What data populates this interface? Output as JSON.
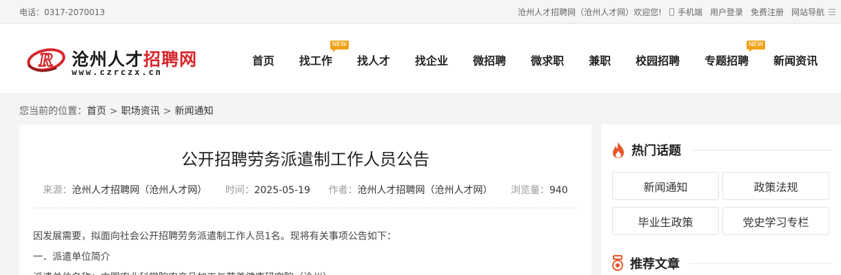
{
  "topbar": {
    "phone": "电话：0317-2070013",
    "welcome": "沧州人才招聘网（沧州人才网）欢迎您!",
    "mobile": "手机端",
    "login": "用户登录",
    "register": "免费注册",
    "sitenav": "网站导航"
  },
  "logo": {
    "title_part1": "沧州人才",
    "title_part2": "招聘网",
    "url": "www.czrczx.cn",
    "brand_color": "#d6262c"
  },
  "nav": {
    "items": [
      {
        "label": "首页"
      },
      {
        "label": "找工作",
        "badge": "NEW"
      },
      {
        "label": "找人才"
      },
      {
        "label": "找企业"
      },
      {
        "label": "微招聘"
      },
      {
        "label": "微求职"
      },
      {
        "label": "兼职"
      },
      {
        "label": "校园招聘"
      },
      {
        "label": "专题招聘",
        "badge": "NEW"
      },
      {
        "label": "新闻资讯"
      }
    ]
  },
  "breadcrumb": {
    "prefix": "您当前的位置：",
    "items": [
      "首页",
      "职场资讯",
      "新闻通知"
    ],
    "separator": ">"
  },
  "article": {
    "title": "公开招聘劳务派遣制工作人员公告",
    "source_label": "来源：",
    "source": "沧州人才招聘网（沧州人才网）",
    "time_label": "时间：",
    "time": "2025-05-19",
    "author_label": "作者：",
    "author": "沧州人才招聘网（沧州人才网）",
    "views_label": "浏览量：",
    "views": "940",
    "paragraphs": [
      "因发展需要，拟面向社会公开招聘劳务派遣制工作人员1名。现将有关事项公告如下：",
      "一．派遣单位简介",
      "派遣单位名称：中国农业科学院农产品加工与营养健康研究院（沧州）"
    ]
  },
  "sidebar": {
    "hot_title": "热门话题",
    "tags": [
      "新闻通知",
      "政策法规",
      "毕业生政策",
      "党史学习专栏"
    ],
    "recommend_title": "推荐文章",
    "accent_color": "#e8542a"
  }
}
